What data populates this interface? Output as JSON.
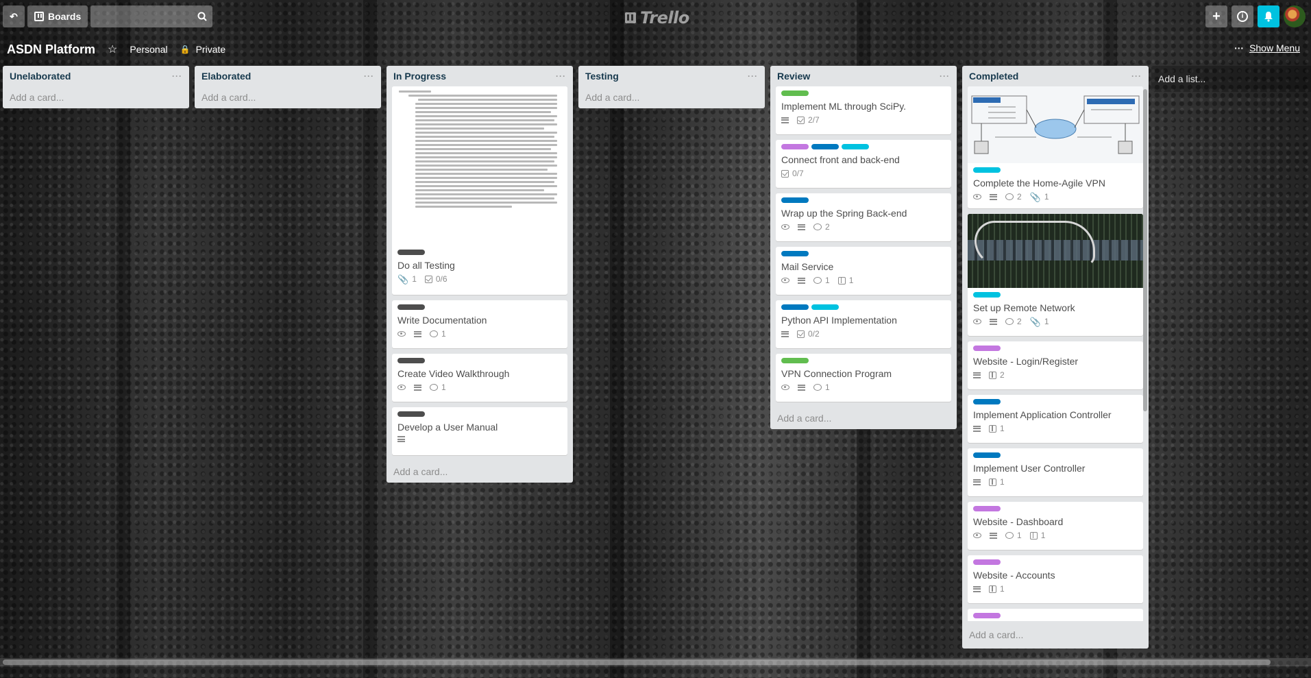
{
  "header": {
    "boards_label": "Boards",
    "logo_text": "Trello"
  },
  "board": {
    "title": "ASDN Platform",
    "team": "Personal",
    "visibility": "Private",
    "show_menu": "Show Menu",
    "add_list": "Add a list..."
  },
  "add_card_label": "Add a card...",
  "colors": {
    "green": "#61bd4f",
    "purple": "#c377e0",
    "blue": "#0079bf",
    "sky": "#00c2e0",
    "black": "#4d4d4d"
  },
  "lists": {
    "unelaborated": {
      "title": "Unelaborated"
    },
    "elaborated": {
      "title": "Elaborated"
    },
    "in_progress": {
      "title": "In Progress",
      "cards": [
        {
          "title": "Do all Testing",
          "attachments": "1",
          "checklist": "0/6"
        },
        {
          "title": "Write Documentation",
          "comments": "1"
        },
        {
          "title": "Create Video Walkthrough",
          "comments": "1"
        },
        {
          "title": "Develop a User Manual"
        }
      ]
    },
    "testing": {
      "title": "Testing"
    },
    "review": {
      "title": "Review",
      "cards": [
        {
          "title": "Implement ML through SciPy.",
          "checklist": "2/7"
        },
        {
          "title": "Connect front and back-end",
          "checklist": "0/7"
        },
        {
          "title": "Wrap up the Spring Back-end",
          "comments": "2"
        },
        {
          "title": "Mail Service",
          "comments": "1",
          "boards": "1"
        },
        {
          "title": "Python API Implementation",
          "checklist": "0/2"
        },
        {
          "title": "VPN Connection Program",
          "comments": "1"
        }
      ]
    },
    "completed": {
      "title": "Completed",
      "cards": [
        {
          "title": "Complete the Home-Agile VPN",
          "comments": "2",
          "attachments": "1"
        },
        {
          "title": "Set up Remote Network",
          "comments": "2",
          "attachments": "1"
        },
        {
          "title": "Website - Login/Register",
          "boards": "2"
        },
        {
          "title": "Implement Application Controller",
          "boards": "1"
        },
        {
          "title": "Implement User Controller",
          "boards": "1"
        },
        {
          "title": "Website - Dashboard",
          "comments": "1",
          "boards": "1"
        },
        {
          "title": "Website - Accounts",
          "boards": "1"
        }
      ]
    }
  },
  "icons": {
    "back": "back-arrow-icon",
    "search": "search-icon",
    "add": "plus-icon",
    "info": "info-icon",
    "notifications": "bell-icon",
    "star": "star-icon",
    "lock": "lock-icon",
    "menu": "ellipsis-icon"
  }
}
